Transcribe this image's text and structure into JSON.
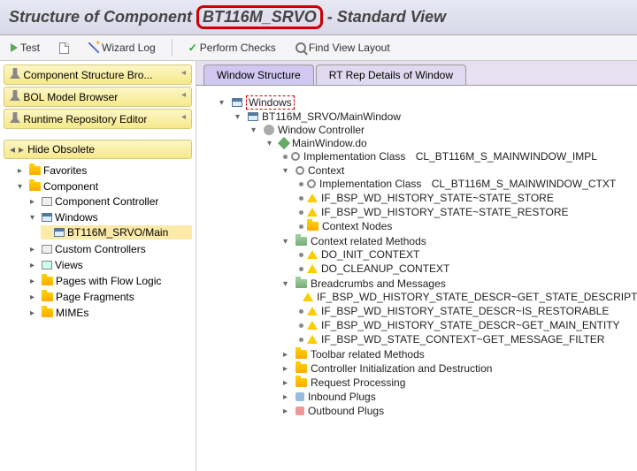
{
  "header": {
    "pre": "Structure of Component ",
    "name": "BT116M_SRVO",
    "post": " - Standard View"
  },
  "toolbar": {
    "test": "Test",
    "wizlog": "Wizard Log",
    "checks": "Perform Checks",
    "findview": "Find View Layout"
  },
  "nav": {
    "b1": "Component Structure Bro...",
    "b2": "BOL Model Browser",
    "b3": "Runtime Repository Editor",
    "hide": "Hide Obsolete"
  },
  "ltree": {
    "fav": "Favorites",
    "comp": "Component",
    "cc": "Component Controller",
    "win": "Windows",
    "winitem": "BT116M_SRVO/Main",
    "custc": "Custom Controllers",
    "views": "Views",
    "pages": "Pages with Flow Logic",
    "frag": "Page Fragments",
    "mimes": "MIMEs"
  },
  "tabs": {
    "t1": "Window Structure",
    "t2": "RT Rep Details of Window"
  },
  "rtree": {
    "root": "Windows",
    "mainwin": "BT116M_SRVO/MainWindow",
    "wc": "Window Controller",
    "mwdo": "MainWindow.do",
    "impl": "Implementation Class",
    "impl_v": "CL_BT116M_S_MAINWINDOW_IMPL",
    "ctx": "Context",
    "impl2_v": "CL_BT116M_S_MAINWINDOW_CTXT",
    "if1": "IF_BSP_WD_HISTORY_STATE~STATE_STORE",
    "if2": "IF_BSP_WD_HISTORY_STATE~STATE_RESTORE",
    "ctxnodes": "Context Nodes",
    "ctxm": "Context related Methods",
    "doinit": "DO_INIT_CONTEXT",
    "doclean": "DO_CLEANUP_CONTEXT",
    "bcm": "Breadcrumbs and Messages",
    "bf1": "IF_BSP_WD_HISTORY_STATE_DESCR~GET_STATE_DESCRIPTION",
    "bf2": "IF_BSP_WD_HISTORY_STATE_DESCR~IS_RESTORABLE",
    "bf3": "IF_BSP_WD_HISTORY_STATE_DESCR~GET_MAIN_ENTITY",
    "bf4": "IF_BSP_WD_STATE_CONTEXT~GET_MESSAGE_FILTER",
    "tbm": "Toolbar related Methods",
    "cid": "Controller Initialization and Destruction",
    "req": "Request Processing",
    "inp": "Inbound Plugs",
    "outp": "Outbound Plugs"
  }
}
